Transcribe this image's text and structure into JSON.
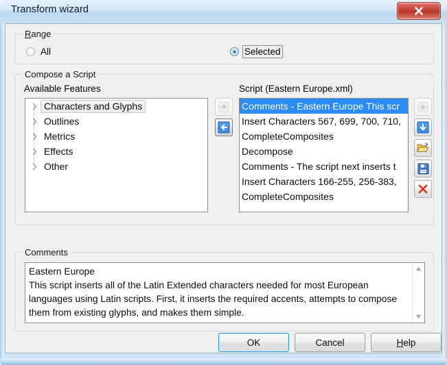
{
  "window": {
    "title": "Transform wizard",
    "close_icon": "close-icon",
    "accent_blue": "#2a8bf2",
    "close_red": "#c23f33",
    "dialog_bg": "#f0f0f0"
  },
  "range_group": {
    "title": "Range",
    "accel": "R",
    "title_rest": "ange",
    "options": [
      {
        "label": "All",
        "checked": false,
        "focused": false
      },
      {
        "label": "Selected",
        "checked": true,
        "focused": true
      }
    ]
  },
  "compose_group": {
    "title": "Compose a Script",
    "available_label": "Available Features",
    "available_features": [
      {
        "label": "Characters and Glyphs",
        "expander": "chevron-right-icon",
        "hovered": true
      },
      {
        "label": "Outlines",
        "expander": "chevron-right-icon",
        "hovered": false
      },
      {
        "label": "Metrics",
        "expander": "chevron-right-icon",
        "hovered": false
      },
      {
        "label": "Effects",
        "expander": "chevron-right-icon",
        "hovered": false
      },
      {
        "label": "Other",
        "expander": "chevron-right-icon",
        "hovered": false
      }
    ],
    "script_label": "Script (Eastern Europe.xml)",
    "script_items": [
      {
        "label": "Comments - Eastern Europe This scr",
        "selected": true
      },
      {
        "label": "Insert Characters 567, 699, 700, 710,",
        "selected": false
      },
      {
        "label": "CompleteComposites",
        "selected": false
      },
      {
        "label": "Decompose",
        "selected": false
      },
      {
        "label": "Comments - The script next inserts t",
        "selected": false
      },
      {
        "label": "Insert Characters 166-255, 256-383,",
        "selected": false
      },
      {
        "label": "CompleteComposites",
        "selected": false
      }
    ],
    "transfer_buttons": [
      {
        "name": "add-to-script-button",
        "icon": "arrow-right-icon",
        "state": "disabled"
      },
      {
        "name": "remove-from-script-button",
        "icon": "arrow-left-icon",
        "state": "pressed"
      }
    ],
    "script_buttons": [
      {
        "name": "move-up-button",
        "icon": "arrow-up-icon",
        "state": "disabled"
      },
      {
        "name": "move-down-button",
        "icon": "arrow-down-icon",
        "state": "enabled"
      },
      {
        "name": "open-script-button",
        "icon": "folder-open-icon",
        "state": "enabled"
      },
      {
        "name": "save-script-button",
        "icon": "floppy-save-icon",
        "state": "enabled"
      },
      {
        "name": "delete-script-button",
        "icon": "red-x-delete-icon",
        "state": "enabled"
      }
    ]
  },
  "comments_group": {
    "title": "Comments",
    "line1": "Eastern Europe",
    "line2": "This script inserts all of the Latin Extended characters needed for most European languages using Latin scripts. First, it inserts the required accents, attempts to compose them from existing glyphs, and makes them simple.",
    "scrollbar": {
      "up_icon": "scroll-up-arrow-icon",
      "down_icon": "scroll-down-arrow-icon"
    }
  },
  "footer": {
    "ok_label": "OK",
    "cancel_label": "Cancel",
    "help_accel": "H",
    "help_rest": "elp"
  }
}
